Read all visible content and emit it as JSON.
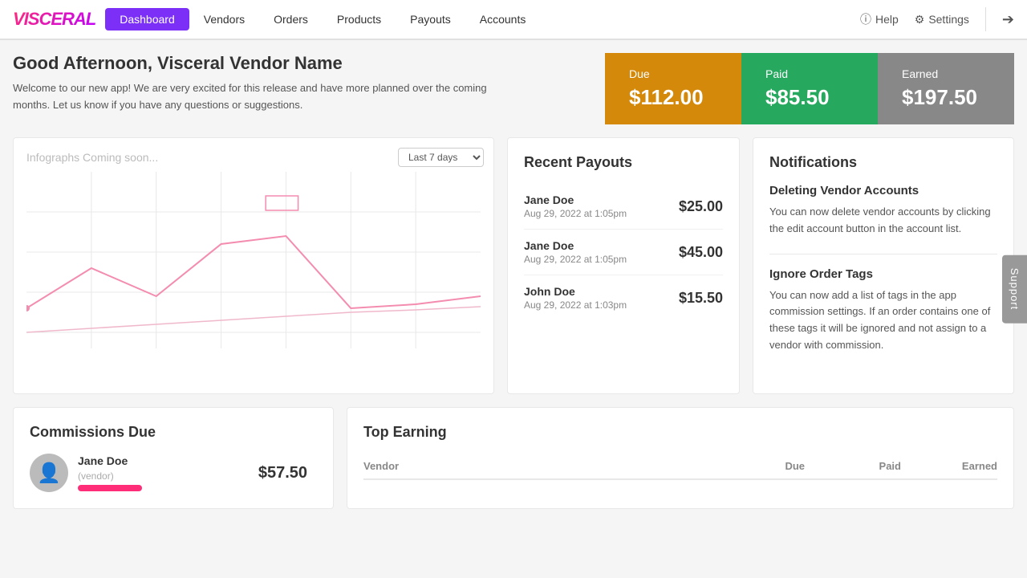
{
  "logo": {
    "text": "VISCERAL"
  },
  "nav": {
    "items": [
      {
        "label": "Dashboard",
        "active": true
      },
      {
        "label": "Vendors",
        "active": false
      },
      {
        "label": "Orders",
        "active": false
      },
      {
        "label": "Products",
        "active": false
      },
      {
        "label": "Payouts",
        "active": false
      },
      {
        "label": "Accounts",
        "active": false
      }
    ],
    "help_label": "Help",
    "settings_label": "Settings"
  },
  "greeting": {
    "title": "Good Afternoon, Visceral Vendor Name",
    "text": "Welcome to our new app! We are very excited for this release and have more planned over the coming months. Let us know if you have any questions or suggestions."
  },
  "stats": {
    "due": {
      "label": "Due",
      "value": "$112.00"
    },
    "paid": {
      "label": "Paid",
      "value": "$85.50"
    },
    "earned": {
      "label": "Earned",
      "value": "$197.50"
    }
  },
  "chart": {
    "label": "Infographs Coming soon...",
    "period_label": "Last 7 days"
  },
  "payouts": {
    "title": "Recent Payouts",
    "items": [
      {
        "name": "Jane Doe",
        "date": "Aug 29, 2022 at 1:05pm",
        "amount": "$25.00"
      },
      {
        "name": "Jane Doe",
        "date": "Aug 29, 2022 at 1:05pm",
        "amount": "$45.00"
      },
      {
        "name": "John Doe",
        "date": "Aug 29, 2022 at 1:03pm",
        "amount": "$15.50"
      }
    ]
  },
  "notifications": {
    "title": "Notifications",
    "items": [
      {
        "title": "Deleting Vendor Accounts",
        "text": "You can now delete vendor accounts by clicking the edit account button in the account list."
      },
      {
        "title": "Ignore Order Tags",
        "text": "You can now add a list of tags in the app commission settings. If an order contains one of these tags it will be ignored and not assign to a vendor with commission."
      }
    ]
  },
  "support": {
    "label": "Support"
  },
  "commissions": {
    "title": "Commissions Due",
    "items": [
      {
        "name": "Jane Doe",
        "sub": "(vendor)",
        "amount": "$57.50"
      }
    ]
  },
  "top_earning": {
    "title": "Top Earning",
    "columns": [
      "Vendor",
      "Due",
      "Paid",
      "Earned"
    ]
  }
}
